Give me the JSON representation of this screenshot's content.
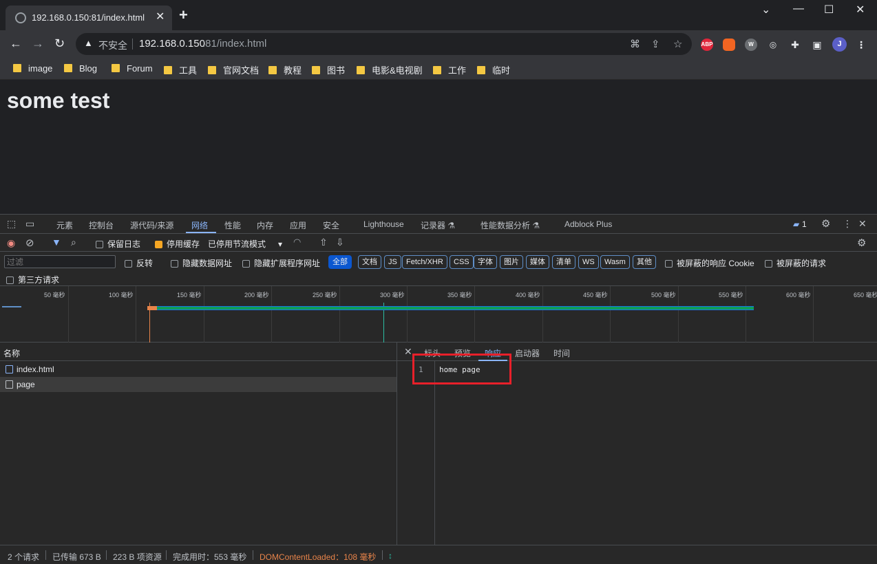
{
  "browser": {
    "tab_title": "192.168.0.150:81/index.html",
    "tab_close": "✕",
    "new_tab": "+",
    "window_controls": {
      "minimize": "—",
      "restore": "☐",
      "close": "✕",
      "menu": "⌄"
    },
    "security_label": "不安全",
    "url_host": "192.168.0.150",
    "url_rest": ":81/index.html",
    "profile_initial": "J",
    "extensions": [
      "ABP",
      "W"
    ]
  },
  "bookmarks": [
    "image",
    "Blog",
    "Forum",
    "工具",
    "官网文档",
    "教程",
    "图书",
    "电影&电视剧",
    "工作",
    "临时"
  ],
  "page": {
    "heading": "some test"
  },
  "devtools": {
    "tabs": [
      "元素",
      "控制台",
      "源代码/来源",
      "网络",
      "性能",
      "内存",
      "应用",
      "安全",
      "Lighthouse",
      "记录器 ⚗",
      "性能数据分析 ⚗",
      "Adblock Plus"
    ],
    "issues_count": "1",
    "toolbar": {
      "preserve_log": "保留日志",
      "disable_cache": "停用缓存",
      "throttle": "已停用节流模式"
    },
    "filter": {
      "placeholder": "过滤",
      "invert": "反转",
      "hide_data_urls": "隐藏数据网址",
      "hide_ext_urls": "隐藏扩展程序网址",
      "types": [
        "全部",
        "文档",
        "JS",
        "Fetch/XHR",
        "CSS",
        "字体",
        "图片",
        "媒体",
        "清单",
        "WS",
        "Wasm",
        "其他"
      ],
      "blocked_cookies": "被屏蔽的响应 Cookie",
      "blocked_requests": "被屏蔽的请求",
      "third_party": "第三方请求"
    },
    "timeline_ticks": [
      "50 毫秒",
      "100 毫秒",
      "150 毫秒",
      "200 毫秒",
      "250 毫秒",
      "300 毫秒",
      "350 毫秒",
      "400 毫秒",
      "450 毫秒",
      "500 毫秒",
      "550 毫秒",
      "600 毫秒",
      "650 毫秒"
    ],
    "request_list": {
      "header": "名称",
      "rows": [
        "index.html",
        "page"
      ]
    },
    "detail": {
      "close": "✕",
      "tabs": [
        "标头",
        "预览",
        "响应",
        "启动器",
        "时间"
      ],
      "line_number": "1",
      "response_text": "home page"
    },
    "status": {
      "requests": "2 个请求",
      "transferred": "已传输 673 B",
      "resources": "223 B 项资源",
      "finish": "完成用时：553 毫秒",
      "dcl": "DOMContentLoaded：108 毫秒"
    }
  }
}
